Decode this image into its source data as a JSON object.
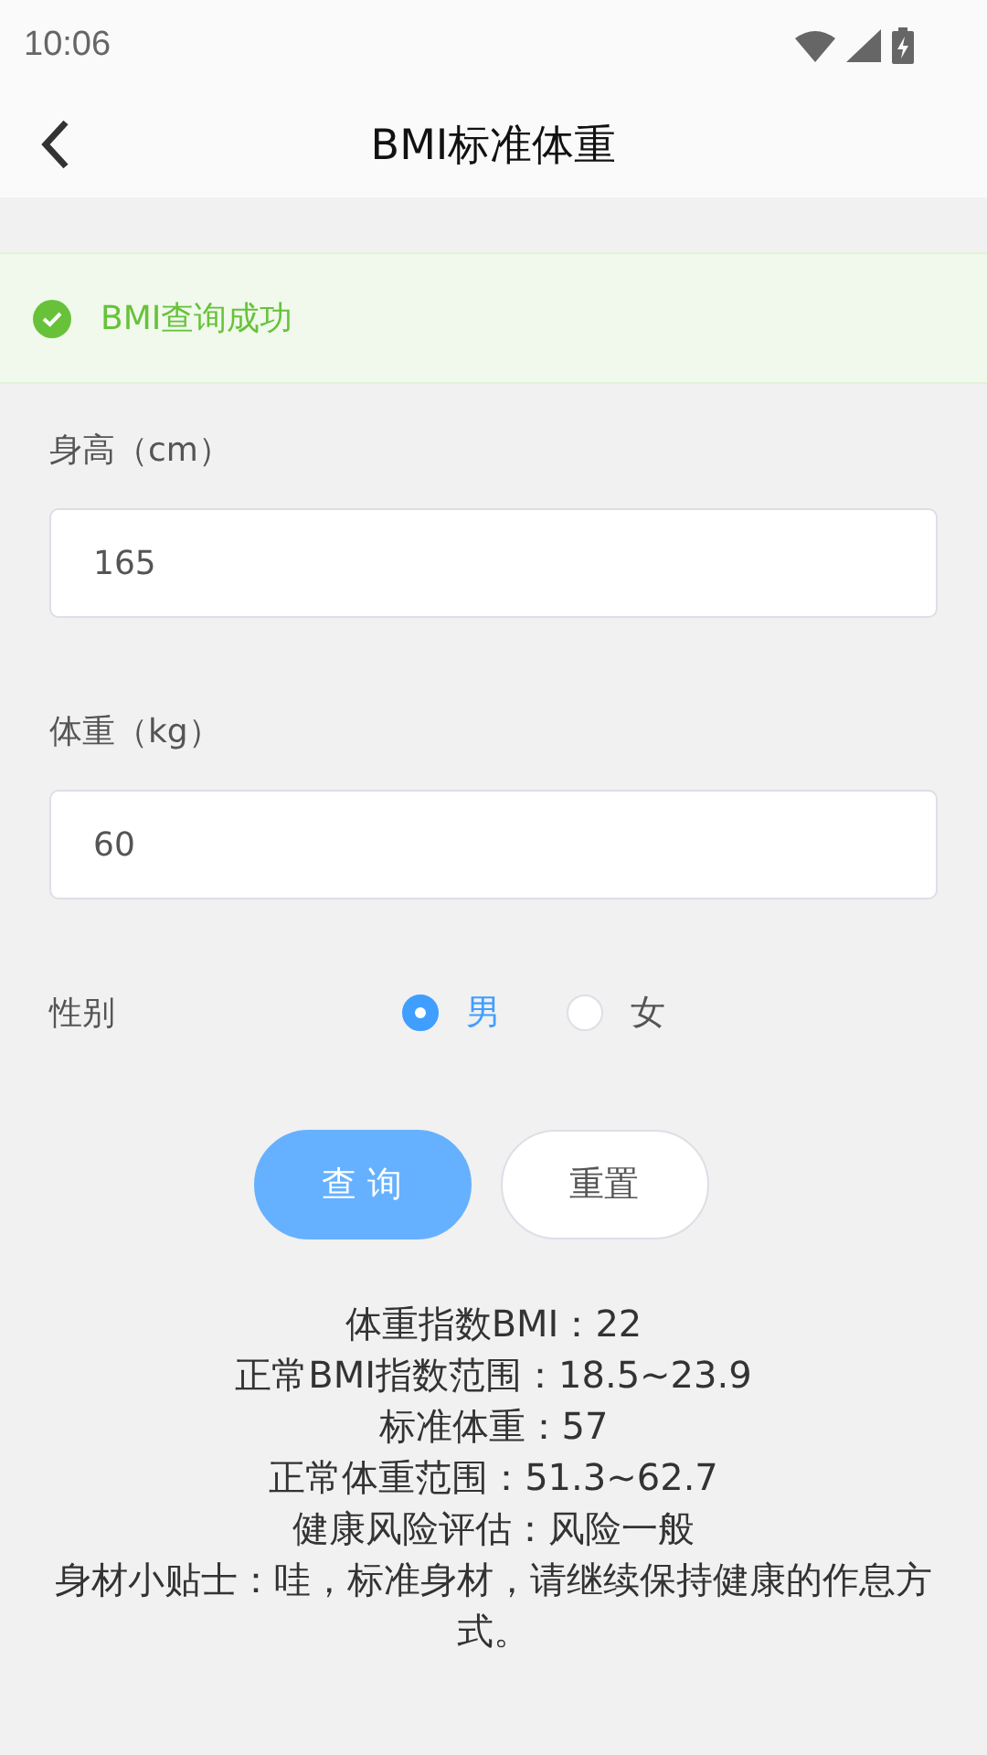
{
  "status_bar": {
    "time": "10:06"
  },
  "header": {
    "title": "BMI标准体重"
  },
  "alert": {
    "kind": "success",
    "text": "BMI查询成功"
  },
  "fields": [
    {
      "label": "身高（cm）",
      "value": "165"
    },
    {
      "label": "体重（kg）",
      "value": "60"
    }
  ],
  "gender": {
    "label": "性别",
    "options": [
      {
        "label": "男",
        "selected": true
      },
      {
        "label": "女",
        "selected": false
      }
    ]
  },
  "buttons": [
    {
      "kind": "primary",
      "label": "查 询"
    },
    {
      "kind": "plain",
      "label": "重置"
    }
  ],
  "results": [
    "体重指数BMI：22",
    "正常BMI指数范围：18.5~23.9",
    "标准体重：57",
    "正常体重范围：51.3~62.7",
    "健康风险评估：风险一般",
    "身材小贴士：哇，标准身材，请继续保持健康的作息方式。"
  ]
}
